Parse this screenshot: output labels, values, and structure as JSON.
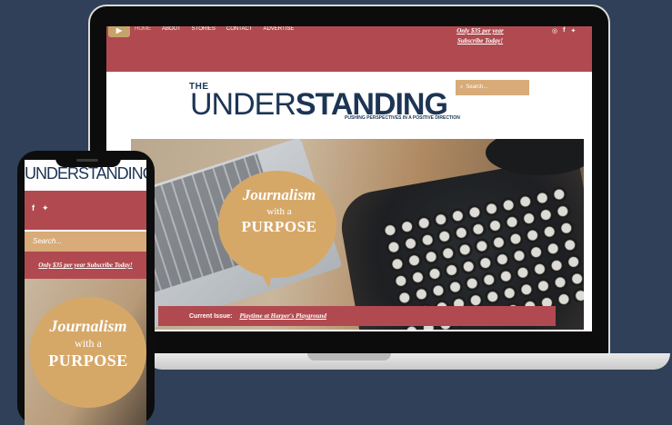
{
  "desktop": {
    "nav": [
      "HOME",
      "ABOUT",
      "STORIES",
      "CONTACT",
      "ADVERTISE"
    ],
    "promo_line1": "Only $35 per year",
    "promo_line2": "Subscribe Today!",
    "social_icons": [
      "instagram-icon",
      "facebook-icon",
      "twitter-icon"
    ],
    "logo": {
      "the": "THE",
      "under": "UNDER",
      "standing": "STANDING",
      "tagline": "PUSHING PERSPECTIVES IN A POSITIVE DIRECTION"
    },
    "search_placeholder": "Search...",
    "hero": {
      "line1": "Journalism",
      "line2": "with a",
      "line3": "PURPOSE"
    },
    "current_issue_label": "Current Issue:",
    "current_issue_link": "Playtime at Harper's Playground"
  },
  "mobile": {
    "logo": "UNDERSTANDING",
    "search_placeholder": "Search...",
    "promo": "Only $35 per year Subscribe Today!",
    "hero": {
      "line1": "Journalism",
      "line2": "with a",
      "line3": "PURPOSE"
    }
  },
  "colors": {
    "background": "#2f4058",
    "brand_red": "#b14a50",
    "brand_tan": "#d8ab78",
    "brand_navy": "#1c3554"
  }
}
